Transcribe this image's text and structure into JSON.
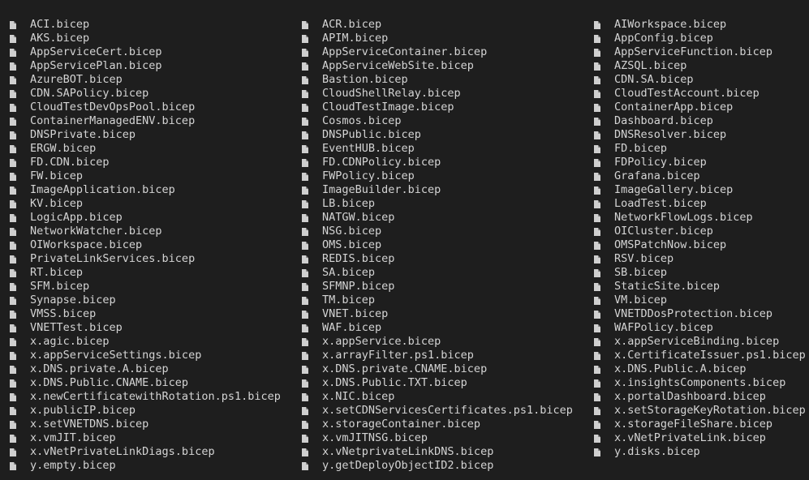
{
  "listing": {
    "columns": [
      {
        "items": [
          "ACI.bicep",
          "AKS.bicep",
          "AppServiceCert.bicep",
          "AppServicePlan.bicep",
          "AzureBOT.bicep",
          "CDN.SAPolicy.bicep",
          "CloudTestDevOpsPool.bicep",
          "ContainerManagedENV.bicep",
          "DNSPrivate.bicep",
          "ERGW.bicep",
          "FD.CDN.bicep",
          "FW.bicep",
          "ImageApplication.bicep",
          "KV.bicep",
          "LogicApp.bicep",
          "NetworkWatcher.bicep",
          "OIWorkspace.bicep",
          "PrivateLinkServices.bicep",
          "RT.bicep",
          "SFM.bicep",
          "Synapse.bicep",
          "VMSS.bicep",
          "VNETTest.bicep",
          "x.agic.bicep",
          "x.appServiceSettings.bicep",
          "x.DNS.private.A.bicep",
          "x.DNS.Public.CNAME.bicep",
          "x.newCertificatewithRotation.ps1.bicep",
          "x.publicIP.bicep",
          "x.setVNETDNS.bicep",
          "x.vmJIT.bicep",
          "x.vNetPrivateLinkDiags.bicep",
          "y.empty.bicep"
        ]
      },
      {
        "items": [
          "ACR.bicep",
          "APIM.bicep",
          "AppServiceContainer.bicep",
          "AppServiceWebSite.bicep",
          "Bastion.bicep",
          "CloudShellRelay.bicep",
          "CloudTestImage.bicep",
          "Cosmos.bicep",
          "DNSPublic.bicep",
          "EventHUB.bicep",
          "FD.CDNPolicy.bicep",
          "FWPolicy.bicep",
          "ImageBuilder.bicep",
          "LB.bicep",
          "NATGW.bicep",
          "NSG.bicep",
          "OMS.bicep",
          "REDIS.bicep",
          "SA.bicep",
          "SFMNP.bicep",
          "TM.bicep",
          "VNET.bicep",
          "WAF.bicep",
          "x.appService.bicep",
          "x.arrayFilter.ps1.bicep",
          "x.DNS.private.CNAME.bicep",
          "x.DNS.Public.TXT.bicep",
          "x.NIC.bicep",
          "x.setCDNServicesCertificates.ps1.bicep",
          "x.storageContainer.bicep",
          "x.vmJITNSG.bicep",
          "x.vNetprivateLinkDNS.bicep",
          "y.getDeployObjectID2.bicep"
        ]
      },
      {
        "items": [
          "AIWorkspace.bicep",
          "AppConfig.bicep",
          "AppServiceFunction.bicep",
          "AZSQL.bicep",
          "CDN.SA.bicep",
          "CloudTestAccount.bicep",
          "ContainerApp.bicep",
          "Dashboard.bicep",
          "DNSResolver.bicep",
          "FD.bicep",
          "FDPolicy.bicep",
          "Grafana.bicep",
          "ImageGallery.bicep",
          "LoadTest.bicep",
          "NetworkFlowLogs.bicep",
          "OICluster.bicep",
          "OMSPatchNow.bicep",
          "RSV.bicep",
          "SB.bicep",
          "StaticSite.bicep",
          "VM.bicep",
          "VNETDDosProtection.bicep",
          "WAFPolicy.bicep",
          "x.appServiceBinding.bicep",
          "x.CertificateIssuer.ps1.bicep",
          "x.DNS.Public.A.bicep",
          "x.insightsComponents.bicep",
          "x.portalDashboard.bicep",
          "x.setStorageKeyRotation.bicep",
          "x.storageFileShare.bicep",
          "x.vNetPrivateLink.bicep",
          "y.disks.bicep"
        ]
      }
    ]
  },
  "colors": {
    "background": "#1e1e1e",
    "text": "#d4d4d4",
    "icon": "#cfcfcf"
  },
  "icons": {
    "file": "file-icon"
  }
}
